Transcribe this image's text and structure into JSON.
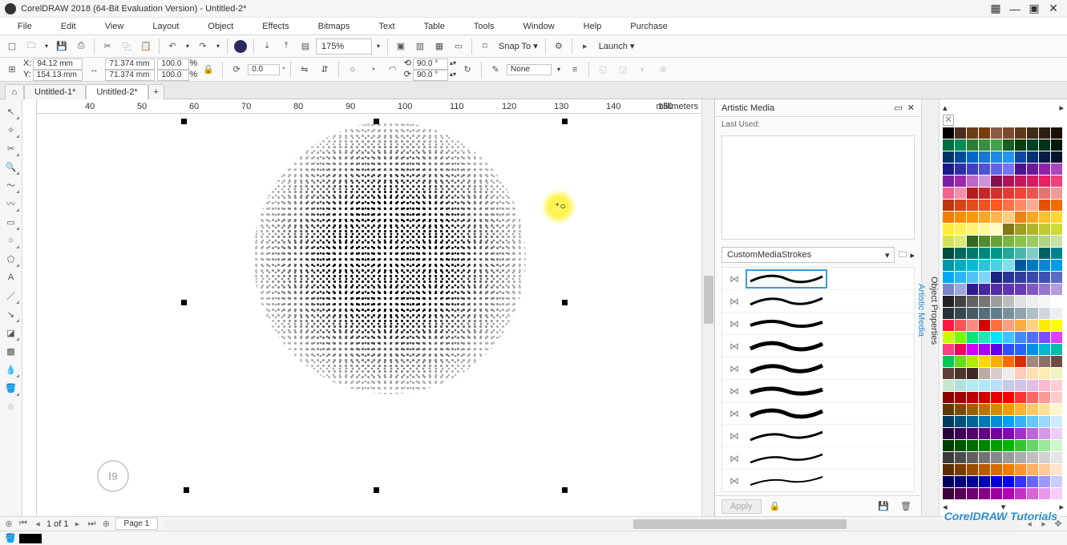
{
  "title": "CorelDRAW 2018 (64-Bit Evaluation Version) - Untitled-2*",
  "menu": [
    "File",
    "Edit",
    "View",
    "Layout",
    "Object",
    "Effects",
    "Bitmaps",
    "Text",
    "Table",
    "Tools",
    "Window",
    "Help",
    "Purchase"
  ],
  "toolbar": {
    "zoom": "175%",
    "snap": "Snap To",
    "launch": "Launch"
  },
  "propbar": {
    "x_label": "X:",
    "x": "94.12 mm",
    "y_label": "Y:",
    "y": "154.13 mm",
    "w": "71.374 mm",
    "h": "71.374 mm",
    "sw": "100.0",
    "sh": "100.0",
    "pct": "%",
    "angle": "0.0",
    "rota": "90.0 °",
    "rotb": "90.0 °",
    "outline": "None"
  },
  "tabs": {
    "t1": "Untitled-1*",
    "t2": "Untitled-2*"
  },
  "ruler_marks": [
    "40",
    "50",
    "60",
    "70",
    "80",
    "90",
    "100",
    "110",
    "120",
    "130",
    "140",
    "150"
  ],
  "ruler_unit": "millimeters",
  "docker": {
    "title": "Artistic Media",
    "last_used": "Last Used:",
    "strokes": "CustomMediaStrokes",
    "apply": "Apply",
    "side1": "Object Properties",
    "side2": "Artistic Media"
  },
  "pagebar": {
    "info": "1 of 1",
    "page": "Page 1"
  },
  "badge": "I9",
  "watermark": "CorelDRAW Tutorials",
  "palette": [
    "#000000",
    "#4b2e1e",
    "#6b3e1a",
    "#7a3b0f",
    "#8a5a44",
    "#7b4b2e",
    "#5e3a1d",
    "#3f2a17",
    "#2d1f12",
    "#1a1208",
    "#006b3f",
    "#008c5a",
    "#2e7d32",
    "#388e3c",
    "#43a047",
    "#1b5e20",
    "#0b3d0b",
    "#004225",
    "#003319",
    "#001a0d",
    "#003366",
    "#004c99",
    "#0066cc",
    "#1976d2",
    "#1e88e5",
    "#2196f3",
    "#0d47a1",
    "#082f6e",
    "#051d44",
    "#02122a",
    "#1a1a8a",
    "#2e2ea8",
    "#3f3fc1",
    "#5151d6",
    "#6363e8",
    "#7575f5",
    "#4a148c",
    "#6a1b9a",
    "#8e24aa",
    "#ab47bc",
    "#7b1fa2",
    "#9c27b0",
    "#ba68c8",
    "#ce93d8",
    "#880e4f",
    "#ad1457",
    "#c2185b",
    "#d81b60",
    "#e91e63",
    "#ec407a",
    "#f06292",
    "#f48fb1",
    "#b71c1c",
    "#c62828",
    "#d32f2f",
    "#e53935",
    "#f44336",
    "#ef5350",
    "#e57373",
    "#ef9a9a",
    "#bf360c",
    "#d84315",
    "#e64a19",
    "#f4511e",
    "#ff5722",
    "#ff7043",
    "#ff8a65",
    "#ffab91",
    "#e65100",
    "#ef6c00",
    "#f57c00",
    "#fb8c00",
    "#ff9800",
    "#ffa726",
    "#ffb74d",
    "#ffcc80",
    "#f57f17",
    "#f9a825",
    "#fbc02d",
    "#fdd835",
    "#ffeb3b",
    "#ffee58",
    "#fff176",
    "#fff59d",
    "#fff9c4",
    "#827717",
    "#9e9d24",
    "#afb42b",
    "#c0ca33",
    "#cddc39",
    "#d4e157",
    "#dce775",
    "#33691e",
    "#558b2f",
    "#689f38",
    "#7cb342",
    "#8bc34a",
    "#9ccc65",
    "#aed581",
    "#c5e1a5",
    "#004d40",
    "#00695c",
    "#00796b",
    "#00897b",
    "#009688",
    "#26a69a",
    "#4db6ac",
    "#80cbc4",
    "#006064",
    "#00838f",
    "#0097a7",
    "#00acc1",
    "#00bcd4",
    "#26c6da",
    "#4dd0e1",
    "#80deea",
    "#01579b",
    "#0277bd",
    "#0288d1",
    "#039be5",
    "#03a9f4",
    "#29b6f6",
    "#4fc3f7",
    "#81d4fa",
    "#1a237e",
    "#283593",
    "#303f9f",
    "#3949ab",
    "#3f51b5",
    "#5c6bc0",
    "#7986cb",
    "#9fa8da",
    "#311b92",
    "#4527a0",
    "#512da8",
    "#5e35b1",
    "#673ab7",
    "#7e57c2",
    "#9575cd",
    "#b39ddb",
    "#212121",
    "#424242",
    "#616161",
    "#757575",
    "#9e9e9e",
    "#bdbdbd",
    "#e0e0e0",
    "#eeeeee",
    "#f5f5f5",
    "#ffffff",
    "#263238",
    "#37474f",
    "#455a64",
    "#546e7a",
    "#607d8b",
    "#78909c",
    "#90a4ae",
    "#b0bec5",
    "#cfd8dc",
    "#eceff1",
    "#ff1744",
    "#ff5252",
    "#ff8a80",
    "#d50000",
    "#ff6e40",
    "#ff9e80",
    "#ffab40",
    "#ffd180",
    "#ffea00",
    "#ffff00",
    "#c6ff00",
    "#76ff03",
    "#00e676",
    "#1de9b6",
    "#00e5ff",
    "#40c4ff",
    "#448aff",
    "#536dfe",
    "#7c4dff",
    "#e040fb",
    "#ff4081",
    "#f50057",
    "#d500f9",
    "#aa00ff",
    "#6200ea",
    "#304ffe",
    "#2962ff",
    "#0091ea",
    "#00b8d4",
    "#00bfa5",
    "#00c853",
    "#64dd17",
    "#aeea00",
    "#ffd600",
    "#ffab00",
    "#ff6d00",
    "#dd2c00",
    "#a1887f",
    "#8d6e63",
    "#6d4c41",
    "#5d4037",
    "#4e342e",
    "#3e2723",
    "#bcaaa4",
    "#d7ccc8",
    "#efebe9",
    "#ffccbc",
    "#ffe0b2",
    "#ffecb3",
    "#f0f4c3",
    "#c8e6c9",
    "#b2dfdb",
    "#b2ebf2",
    "#b3e5fc",
    "#bbdefb",
    "#c5cae9",
    "#d1c4e9",
    "#e1bee7",
    "#f8bbd0",
    "#ffcdd2",
    "#8c0000",
    "#a30000",
    "#bb0000",
    "#d10000",
    "#e80000",
    "#ff0000",
    "#ff3333",
    "#ff6666",
    "#ff9999",
    "#ffcccc",
    "#5c3a00",
    "#7a4d00",
    "#996100",
    "#b87400",
    "#d68800",
    "#f59b00",
    "#ffb233",
    "#ffc966",
    "#ffe099",
    "#fff7cc",
    "#003c5c",
    "#00507a",
    "#006499",
    "#0078b8",
    "#008cd6",
    "#00a0f5",
    "#33b3ff",
    "#66c6ff",
    "#99d9ff",
    "#ccecff",
    "#2a003c",
    "#3c0054",
    "#4f006c",
    "#610084",
    "#74009c",
    "#8600b4",
    "#a033c5",
    "#ba66d6",
    "#d399e7",
    "#edccf8",
    "#003c00",
    "#005400",
    "#006c00",
    "#008400",
    "#009c00",
    "#00b400",
    "#33c533",
    "#66d666",
    "#99e799",
    "#ccf8cc",
    "#3a3a3a",
    "#4d4d4d",
    "#606060",
    "#737373",
    "#868686",
    "#999999",
    "#acacac",
    "#bfbfbf",
    "#d2d2d2",
    "#e5e5e5",
    "#5c2e00",
    "#7a3d00",
    "#994c00",
    "#b85b00",
    "#d66b00",
    "#f57a00",
    "#ff9433",
    "#ffae66",
    "#ffc999",
    "#ffe3cc",
    "#00005c",
    "#00007a",
    "#000099",
    "#0000b8",
    "#0000d6",
    "#0000f5",
    "#3333ff",
    "#6666ff",
    "#9999ff",
    "#ccccff",
    "#3c003c",
    "#540054",
    "#6c006c",
    "#840084",
    "#9c009c",
    "#b400b4",
    "#c533c5",
    "#d666d6",
    "#e799e7",
    "#f8ccf8"
  ]
}
